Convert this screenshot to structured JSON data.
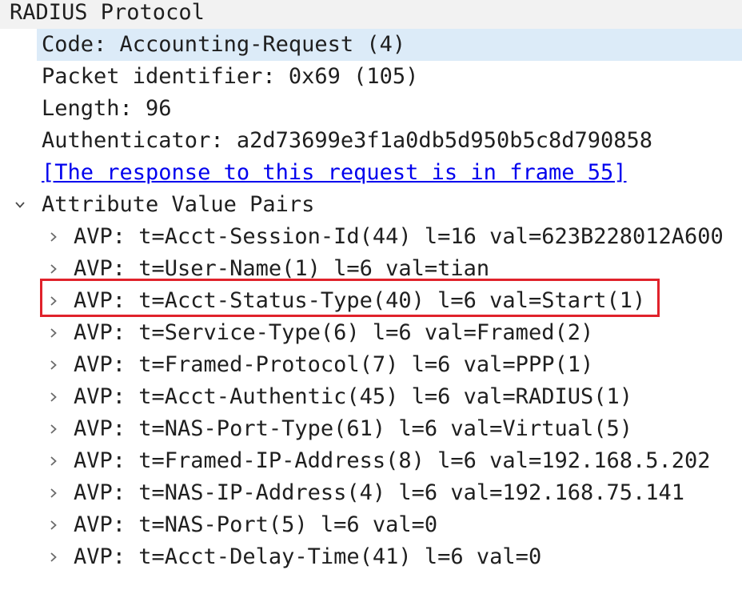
{
  "root": {
    "label": "RADIUS Protocol"
  },
  "fields": {
    "code": "Code: Accounting-Request (4)",
    "packet_identifier": "Packet identifier: 0x69 (105)",
    "length": "Length: 96",
    "authenticator": "Authenticator: a2d73699e3f1a0db5d950b5c8d790858",
    "response_link": "[The response to this request is in frame 55]",
    "avp_group": "Attribute Value Pairs"
  },
  "avps": [
    "AVP: t=Acct-Session-Id(44) l=16 val=623B228012A600",
    "AVP: t=User-Name(1) l=6 val=tian",
    "AVP: t=Acct-Status-Type(40) l=6 val=Start(1)",
    "AVP: t=Service-Type(6) l=6 val=Framed(2)",
    "AVP: t=Framed-Protocol(7) l=6 val=PPP(1)",
    "AVP: t=Acct-Authentic(45) l=6 val=RADIUS(1)",
    "AVP: t=NAS-Port-Type(61) l=6 val=Virtual(5)",
    "AVP: t=Framed-IP-Address(8) l=6 val=192.168.5.202",
    "AVP: t=NAS-IP-Address(4) l=6 val=192.168.75.141",
    "AVP: t=NAS-Port(5) l=6 val=0",
    "AVP: t=Acct-Delay-Time(41) l=6 val=0"
  ],
  "icons": {
    "expander_open": "chevron-down-icon",
    "expander_closed": "chevron-right-icon"
  },
  "colors": {
    "selection": "#dcebf8",
    "root_background": "#f2f2f2",
    "link": "#0000ee",
    "highlight_border": "#e0222b"
  }
}
